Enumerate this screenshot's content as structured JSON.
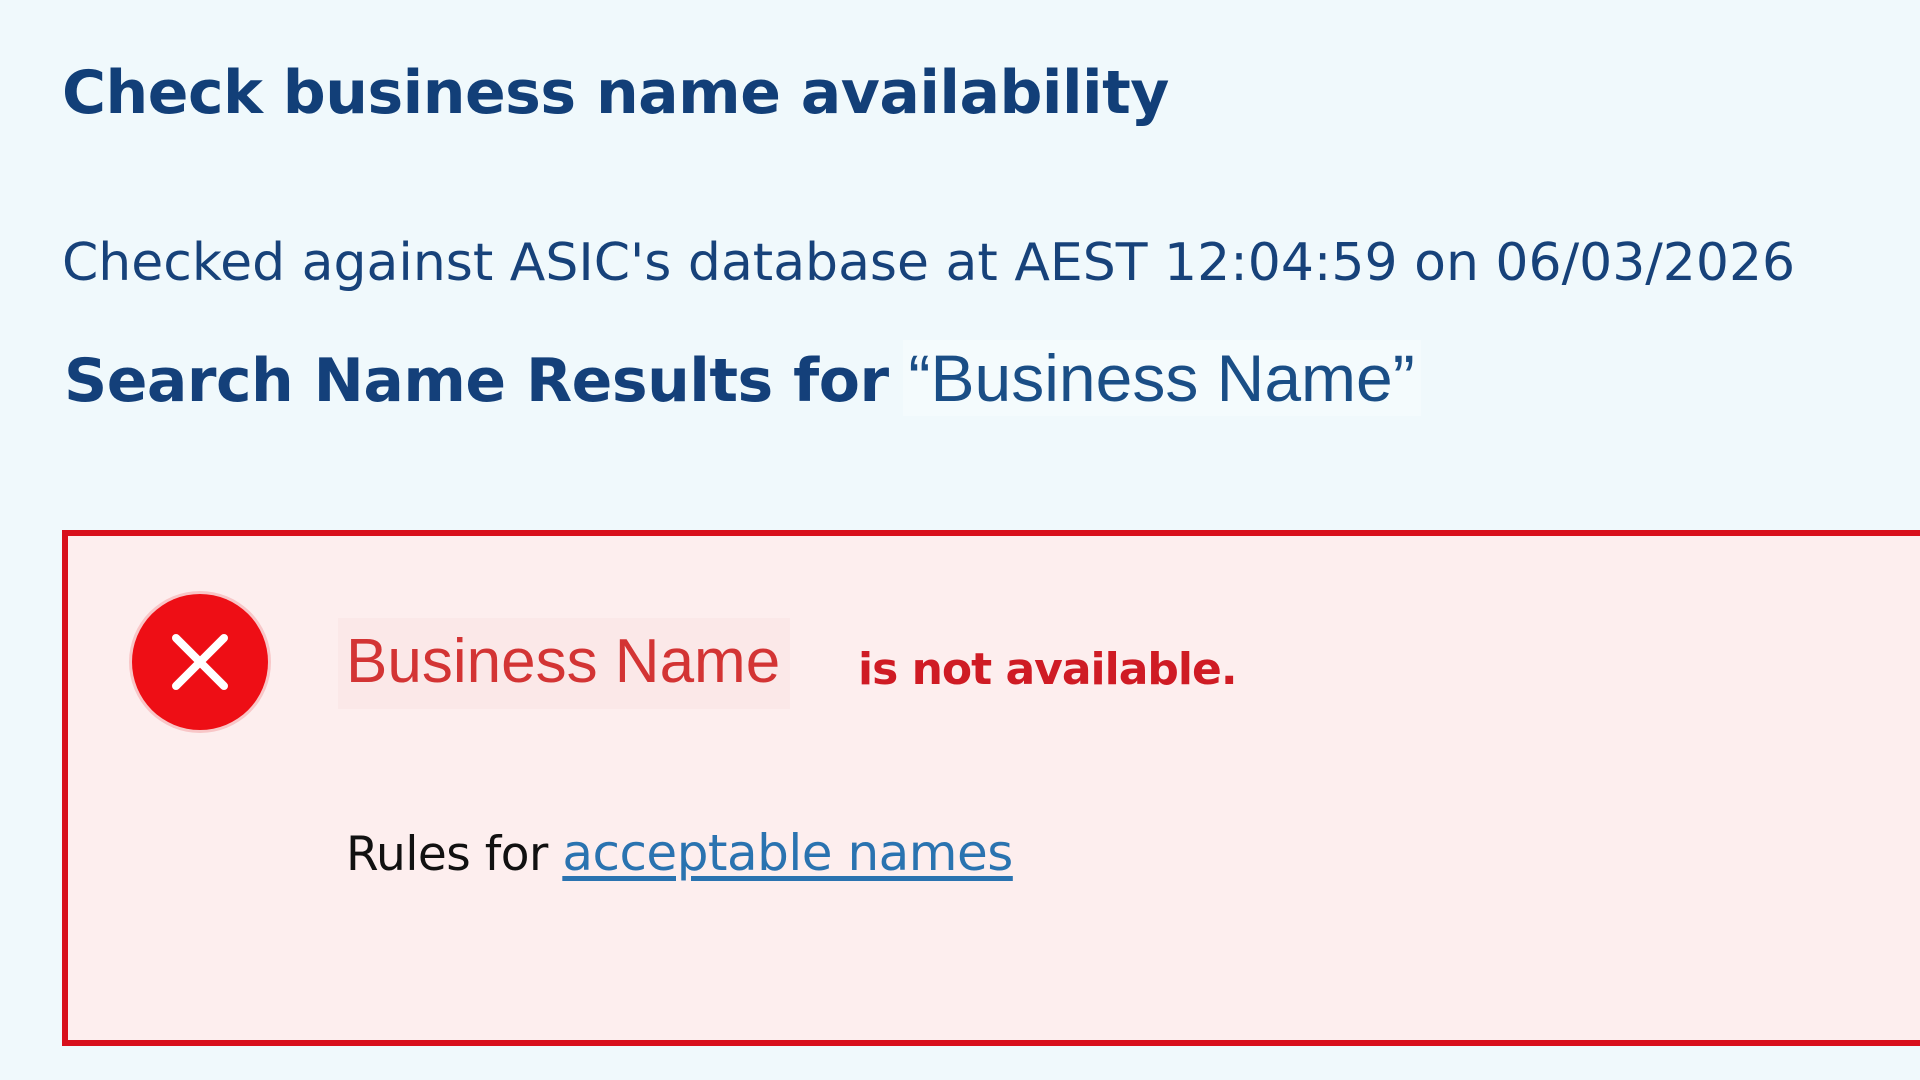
{
  "header": {
    "title": "Check business name availability",
    "checked_text": "Checked against ASIC's database at AEST 12:04:59 on 06/03/2026"
  },
  "results": {
    "label": "Search Name Results for",
    "search_term": "“Business Name”"
  },
  "alert": {
    "icon": "error-x-icon",
    "business_name": "Business Name",
    "status_text": "is not available.",
    "rules_prefix": "Rules for",
    "rules_link": "acceptable names"
  },
  "colors": {
    "title_blue": "#123f78",
    "alert_red": "#d8101c",
    "alert_background": "#fdeeee",
    "link_blue": "#2a73b0"
  }
}
